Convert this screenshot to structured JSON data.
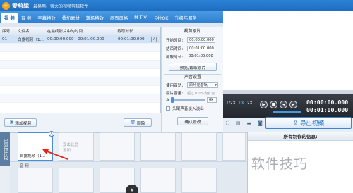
{
  "app": {
    "name": "爱剪辑",
    "slogan": "最易用、强大的视频剪辑软件"
  },
  "tabs": [
    {
      "label": "视 频"
    },
    {
      "label": "音 频"
    },
    {
      "label": "字幕特效"
    },
    {
      "label": "叠加素材"
    },
    {
      "label": "转场特效"
    },
    {
      "label": "画面风格"
    },
    {
      "label": "M T V"
    },
    {
      "label": "卡拉OK"
    },
    {
      "label": "升级与服务"
    }
  ],
  "video_list": {
    "columns": [
      "序号",
      "文件名",
      "在最终影片中的时间",
      "截取时长",
      ""
    ],
    "rows": [
      {
        "index": "01",
        "name": "白露视频（1...",
        "span": "00:00:00.000 - 00:01:00.000",
        "duration": "00:01:00.000",
        "info": "i"
      }
    ],
    "add_button": "添加视频",
    "delete_button": "删除"
  },
  "clip_settings": {
    "title": "裁剪原片",
    "start_label": "开始时间:",
    "start_value": "00:00:00.000",
    "end_label": "结束时间:",
    "end_value": "00:01:00.000",
    "duration_label": "截取时长:",
    "duration_value": "00:01:00.000",
    "preview_button": "预览/截取原片"
  },
  "audio_settings": {
    "title": "声音设置",
    "track_label": "使用音轨:",
    "track_value": "原片无音轨",
    "volume_label": "原片音量:",
    "volume_hint": "超过100%为扩音",
    "volume_value": "0k",
    "fade_label": "头尾声音淡入淡出",
    "confirm_button": "确认修改"
  },
  "player": {
    "speeds": [
      "1/2X",
      "1X",
      "2X"
    ],
    "time_current": "00:00:00.000",
    "time_total": "00:01:00.000"
  },
  "export": {
    "label": "导出视频"
  },
  "timeline": {
    "side_label": "已添加片段",
    "first_clip_label": "白露视频（1...",
    "add_hint": "双击此处添加",
    "audio_label": "音 频"
  },
  "info_panel": {
    "title": "所有制作的信息:"
  },
  "watermark": "软件技巧"
}
